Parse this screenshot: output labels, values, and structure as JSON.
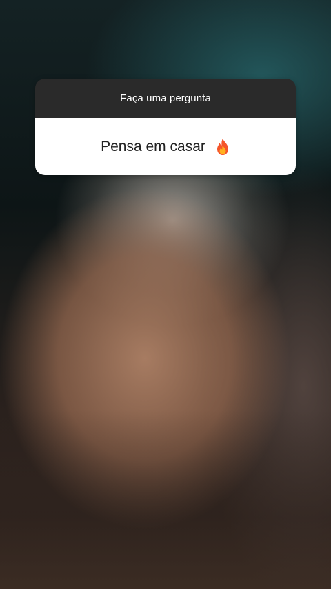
{
  "story": {
    "question_sticker": {
      "prompt": "Faça uma pergunta",
      "answer": "Pensa em casar",
      "emoji_icon": "fire-icon"
    }
  },
  "colors": {
    "sticker_header_bg": "#2a2a2a",
    "sticker_body_bg": "#ffffff"
  }
}
